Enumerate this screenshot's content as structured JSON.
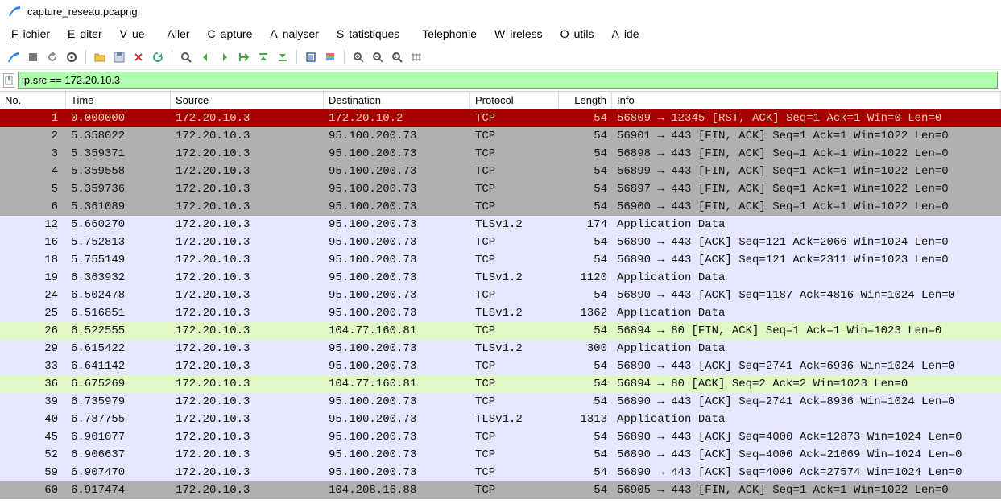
{
  "window": {
    "title": "capture_reseau.pcapng"
  },
  "menu": {
    "fichier": "Fichier",
    "editer": "Editer",
    "vue": "Vue",
    "aller": "Aller",
    "capture": "Capture",
    "analyser": "Analyser",
    "statistiques": "Statistiques",
    "telephonie": "Telephonie",
    "wireless": "Wireless",
    "outils": "Outils",
    "aide": "Aide"
  },
  "filter": {
    "value": "ip.src == 172.20.10.3"
  },
  "columns": {
    "no": "No.",
    "time": "Time",
    "source": "Source",
    "destination": "Destination",
    "protocol": "Protocol",
    "length": "Length",
    "info": "Info"
  },
  "packets": [
    {
      "no": "1",
      "time": "0.000000",
      "src": "172.20.10.3",
      "dst": "172.20.10.2",
      "proto": "TCP",
      "len": "54",
      "info": "56809 → 12345 [RST, ACK] Seq=1 Ack=1 Win=0 Len=0",
      "color": "red"
    },
    {
      "no": "2",
      "time": "5.358022",
      "src": "172.20.10.3",
      "dst": "95.100.200.73",
      "proto": "TCP",
      "len": "54",
      "info": "56901 → 443 [FIN, ACK] Seq=1 Ack=1 Win=1022 Len=0",
      "color": "gray"
    },
    {
      "no": "3",
      "time": "5.359371",
      "src": "172.20.10.3",
      "dst": "95.100.200.73",
      "proto": "TCP",
      "len": "54",
      "info": "56898 → 443 [FIN, ACK] Seq=1 Ack=1 Win=1022 Len=0",
      "color": "gray"
    },
    {
      "no": "4",
      "time": "5.359558",
      "src": "172.20.10.3",
      "dst": "95.100.200.73",
      "proto": "TCP",
      "len": "54",
      "info": "56899 → 443 [FIN, ACK] Seq=1 Ack=1 Win=1022 Len=0",
      "color": "gray"
    },
    {
      "no": "5",
      "time": "5.359736",
      "src": "172.20.10.3",
      "dst": "95.100.200.73",
      "proto": "TCP",
      "len": "54",
      "info": "56897 → 443 [FIN, ACK] Seq=1 Ack=1 Win=1022 Len=0",
      "color": "gray"
    },
    {
      "no": "6",
      "time": "5.361089",
      "src": "172.20.10.3",
      "dst": "95.100.200.73",
      "proto": "TCP",
      "len": "54",
      "info": "56900 → 443 [FIN, ACK] Seq=1 Ack=1 Win=1022 Len=0",
      "color": "gray"
    },
    {
      "no": "12",
      "time": "5.660270",
      "src": "172.20.10.3",
      "dst": "95.100.200.73",
      "proto": "TLSv1.2",
      "len": "174",
      "info": "Application Data",
      "color": "lilac"
    },
    {
      "no": "16",
      "time": "5.752813",
      "src": "172.20.10.3",
      "dst": "95.100.200.73",
      "proto": "TCP",
      "len": "54",
      "info": "56890 → 443 [ACK] Seq=121 Ack=2066 Win=1024 Len=0",
      "color": "lilac"
    },
    {
      "no": "18",
      "time": "5.755149",
      "src": "172.20.10.3",
      "dst": "95.100.200.73",
      "proto": "TCP",
      "len": "54",
      "info": "56890 → 443 [ACK] Seq=121 Ack=2311 Win=1023 Len=0",
      "color": "lilac"
    },
    {
      "no": "19",
      "time": "6.363932",
      "src": "172.20.10.3",
      "dst": "95.100.200.73",
      "proto": "TLSv1.2",
      "len": "1120",
      "info": "Application Data",
      "color": "lilac"
    },
    {
      "no": "24",
      "time": "6.502478",
      "src": "172.20.10.3",
      "dst": "95.100.200.73",
      "proto": "TCP",
      "len": "54",
      "info": "56890 → 443 [ACK] Seq=1187 Ack=4816 Win=1024 Len=0",
      "color": "lilac"
    },
    {
      "no": "25",
      "time": "6.516851",
      "src": "172.20.10.3",
      "dst": "95.100.200.73",
      "proto": "TLSv1.2",
      "len": "1362",
      "info": "Application Data",
      "color": "lilac"
    },
    {
      "no": "26",
      "time": "6.522555",
      "src": "172.20.10.3",
      "dst": "104.77.160.81",
      "proto": "TCP",
      "len": "54",
      "info": "56894 → 80 [FIN, ACK] Seq=1 Ack=1 Win=1023 Len=0",
      "color": "green"
    },
    {
      "no": "29",
      "time": "6.615422",
      "src": "172.20.10.3",
      "dst": "95.100.200.73",
      "proto": "TLSv1.2",
      "len": "300",
      "info": "Application Data",
      "color": "lilac"
    },
    {
      "no": "33",
      "time": "6.641142",
      "src": "172.20.10.3",
      "dst": "95.100.200.73",
      "proto": "TCP",
      "len": "54",
      "info": "56890 → 443 [ACK] Seq=2741 Ack=6936 Win=1024 Len=0",
      "color": "lilac"
    },
    {
      "no": "36",
      "time": "6.675269",
      "src": "172.20.10.3",
      "dst": "104.77.160.81",
      "proto": "TCP",
      "len": "54",
      "info": "56894 → 80 [ACK] Seq=2 Ack=2 Win=1023 Len=0",
      "color": "green"
    },
    {
      "no": "39",
      "time": "6.735979",
      "src": "172.20.10.3",
      "dst": "95.100.200.73",
      "proto": "TCP",
      "len": "54",
      "info": "56890 → 443 [ACK] Seq=2741 Ack=8936 Win=1024 Len=0",
      "color": "lilac"
    },
    {
      "no": "40",
      "time": "6.787755",
      "src": "172.20.10.3",
      "dst": "95.100.200.73",
      "proto": "TLSv1.2",
      "len": "1313",
      "info": "Application Data",
      "color": "lilac"
    },
    {
      "no": "45",
      "time": "6.901077",
      "src": "172.20.10.3",
      "dst": "95.100.200.73",
      "proto": "TCP",
      "len": "54",
      "info": "56890 → 443 [ACK] Seq=4000 Ack=12873 Win=1024 Len=0",
      "color": "lilac"
    },
    {
      "no": "52",
      "time": "6.906637",
      "src": "172.20.10.3",
      "dst": "95.100.200.73",
      "proto": "TCP",
      "len": "54",
      "info": "56890 → 443 [ACK] Seq=4000 Ack=21069 Win=1024 Len=0",
      "color": "lilac"
    },
    {
      "no": "59",
      "time": "6.907470",
      "src": "172.20.10.3",
      "dst": "95.100.200.73",
      "proto": "TCP",
      "len": "54",
      "info": "56890 → 443 [ACK] Seq=4000 Ack=27574 Win=1024 Len=0",
      "color": "lilac"
    },
    {
      "no": "60",
      "time": "6.917474",
      "src": "172.20.10.3",
      "dst": "104.208.16.88",
      "proto": "TCP",
      "len": "54",
      "info": "56905 → 443 [FIN, ACK] Seq=1 Ack=1 Win=1022 Len=0",
      "color": "gray"
    }
  ]
}
